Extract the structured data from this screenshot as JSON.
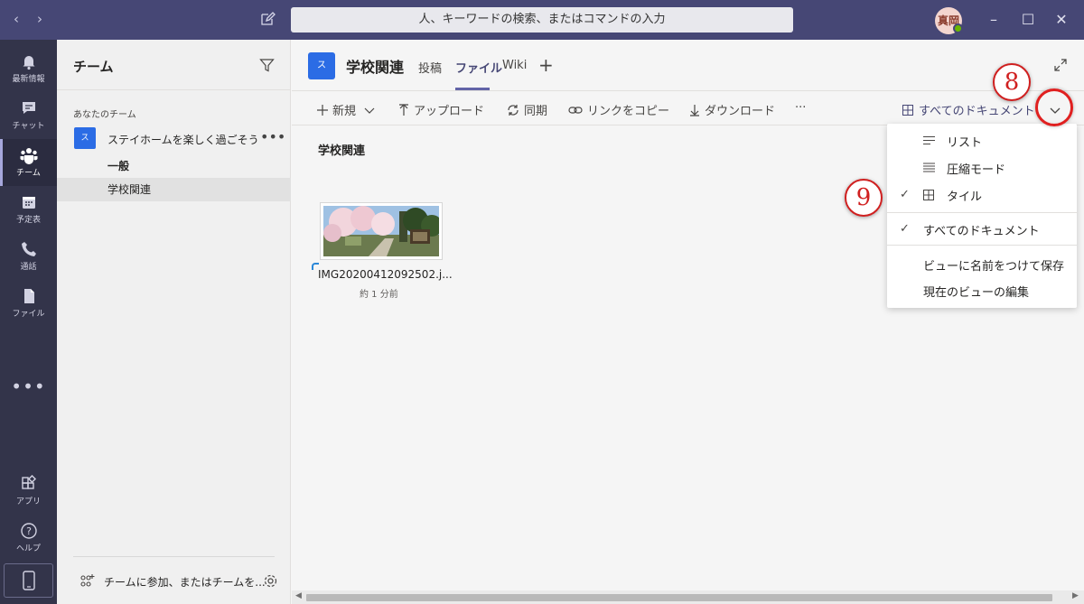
{
  "titlebar": {
    "search_placeholder": "人、キーワードの検索、またはコマンドの入力",
    "avatar_initials": "真岡"
  },
  "rail": {
    "items": [
      {
        "label": "最新情報",
        "icon": "bell-icon"
      },
      {
        "label": "チャット",
        "icon": "chat-icon"
      },
      {
        "label": "チーム",
        "icon": "teams-icon"
      },
      {
        "label": "予定表",
        "icon": "calendar-icon"
      },
      {
        "label": "通話",
        "icon": "phone-icon"
      },
      {
        "label": "ファイル",
        "icon": "file-icon"
      },
      {
        "label": "アプリ",
        "icon": "apps-icon"
      },
      {
        "label": "ヘルプ",
        "icon": "help-icon"
      }
    ],
    "more": "•••"
  },
  "teams_panel": {
    "title": "チーム",
    "section_label": "あなたのチーム",
    "team": {
      "badge": "ス",
      "name": "ステイホームを楽しく過ごそう",
      "more": "•••"
    },
    "channels": [
      "一般",
      "学校関連"
    ],
    "join_text": "チームに参加、またはチームを..."
  },
  "main": {
    "badge": "ス",
    "title": "学校関連",
    "tabs": [
      "投稿",
      "ファイル",
      "Wiki"
    ],
    "active_tab": "ファイル",
    "toolbar": {
      "new": "新規",
      "upload": "アップロード",
      "sync": "同期",
      "copy_link": "リンクをコピー",
      "download": "ダウンロード",
      "more": "···",
      "view": "すべてのドキュメント"
    },
    "folder_title": "学校関連",
    "file": {
      "name": "IMG20200412092502.j...",
      "time": "約 1 分前"
    }
  },
  "dropdown": {
    "items": [
      {
        "label": "リスト",
        "checked": false,
        "icon": "list-icon"
      },
      {
        "label": "圧縮モード",
        "checked": false,
        "icon": "compact-icon"
      },
      {
        "label": "タイル",
        "checked": true,
        "icon": "tiles-icon"
      },
      {
        "label": "すべてのドキュメント",
        "checked": true
      },
      {
        "label": "ビューに名前をつけて保存",
        "checked": false
      },
      {
        "label": "現在のビューの編集",
        "checked": false
      }
    ],
    "check_mark": "✓"
  },
  "annotations": {
    "step8": "8",
    "step9": "9"
  },
  "colors": {
    "titlebar": "#464775",
    "rail": "#33344a",
    "accent": "#6264a7",
    "team_badge": "#2b6ce5",
    "annotation": "#e02020"
  }
}
